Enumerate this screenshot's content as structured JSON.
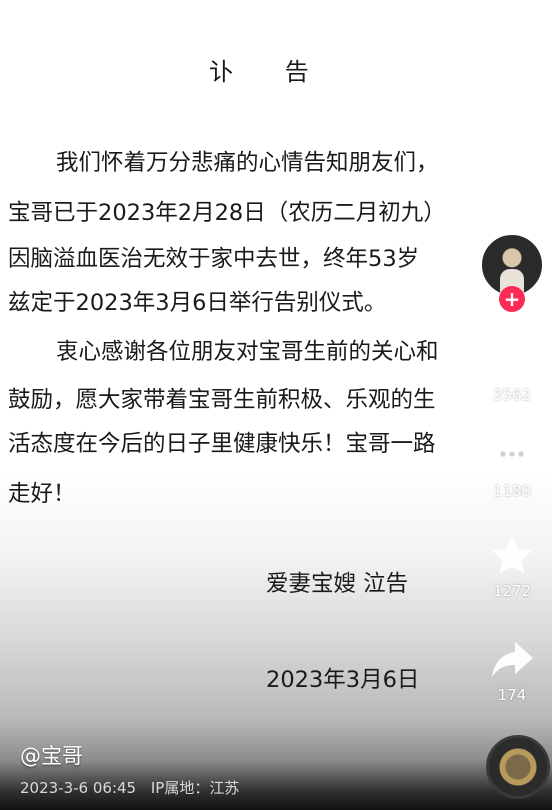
{
  "notice": {
    "title": "讣 告",
    "lines": [
      "我们怀着万分悲痛的心情告知朋友们，",
      "宝哥已于2023年2月28日（农历二月初九）",
      "因脑溢血医治无效于家中去世，终年53岁",
      "兹定于2023年3月6日举行告别仪式。",
      "衷心感谢各位朋友对宝哥生前的关心和",
      "鼓励，愿大家带着宝哥生前积极、乐观的生",
      "活态度在今后的日子里健康快乐！宝哥一路",
      "走好！"
    ],
    "signature": "爱妻宝嫂  泣告",
    "date": "2023年3月6日"
  },
  "sidebar": {
    "follow_symbol": "+",
    "like_count": "3562",
    "comment_count": "1180",
    "favorite_count": "1272",
    "share_count": "174"
  },
  "footer": {
    "author": "@宝哥",
    "timestamp": "2023-3-6 06:45",
    "ip_location": "IP属地：江苏"
  },
  "icons": {
    "like": "heart-icon",
    "comment": "comment-bubble-icon",
    "favorite": "star-icon",
    "share": "share-arrow-icon"
  },
  "colors": {
    "accent": "#fe2c55",
    "text": "#1a1a1a"
  }
}
